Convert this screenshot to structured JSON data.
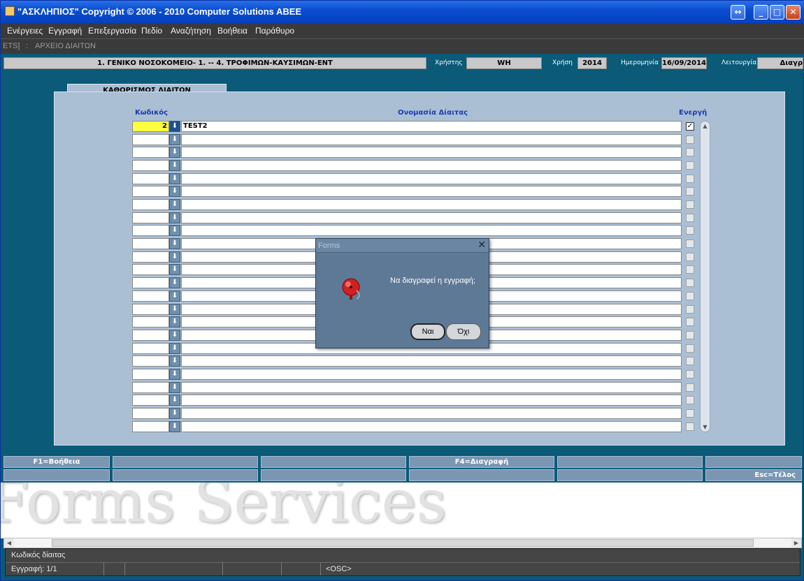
{
  "window": {
    "title": "\"ΑΣΚΛΗΠΙΟΣ\" Copyright © 2006 - 2010 Computer Solutions ABEE"
  },
  "menu": [
    "Ενέργειες",
    "Εγγραφή",
    "Επεξεργασία",
    "Πεδίο",
    "Αναζήτηση",
    "Βοήθεια",
    "Παράθυρο"
  ],
  "breadcrumb": {
    "left": "ETS]",
    "sep": ":",
    "right": "ΑΡΧΕΙΟ ΔΙΑΙΤΩΝ"
  },
  "info": {
    "org": "1. ΓΕΝΙΚΟ ΝΟΣΟΚΟΜΕΙΟ- 1. -- 4. ΤΡΟΦΙΜΩΝ-ΚΑΥΣΙΜΩΝ-ΕΝΤ",
    "user_label": "Χρήστης",
    "user": "WH",
    "year_label": "Χρήση",
    "year": "2014",
    "date_label": "Ημερομηνία",
    "date": "16/09/2014",
    "mode_label": "Λειτουργία",
    "mode": "Διαγρ"
  },
  "form": {
    "tab": "ΚΑΘΟΡΙΣΜΟΣ ΔΙΑΙΤΩΝ",
    "col_code": "Κωδικός",
    "col_name": "Ονομασία Δίαιτας",
    "col_active": "Ενεργή",
    "rows": [
      {
        "code": "2",
        "name": "TEST2",
        "active": true
      }
    ],
    "empty_rows": 23
  },
  "fkeys": {
    "row1": [
      "F1=Βοήθεια",
      "",
      "",
      "F4=Διαγραφή",
      "",
      ""
    ],
    "row2": [
      "",
      "",
      "",
      "",
      "",
      "Esc=Τέλος"
    ]
  },
  "watermark": "Forms Services",
  "status": {
    "hint": "Κωδικός δίαιτας",
    "record": "Εγγραφή: 1/1",
    "osc": "<OSC>"
  },
  "dialog": {
    "title": "Forms",
    "message": "Να διαγραφεί η εγγραφή;",
    "yes": "Ναι",
    "no": "Όχι"
  }
}
